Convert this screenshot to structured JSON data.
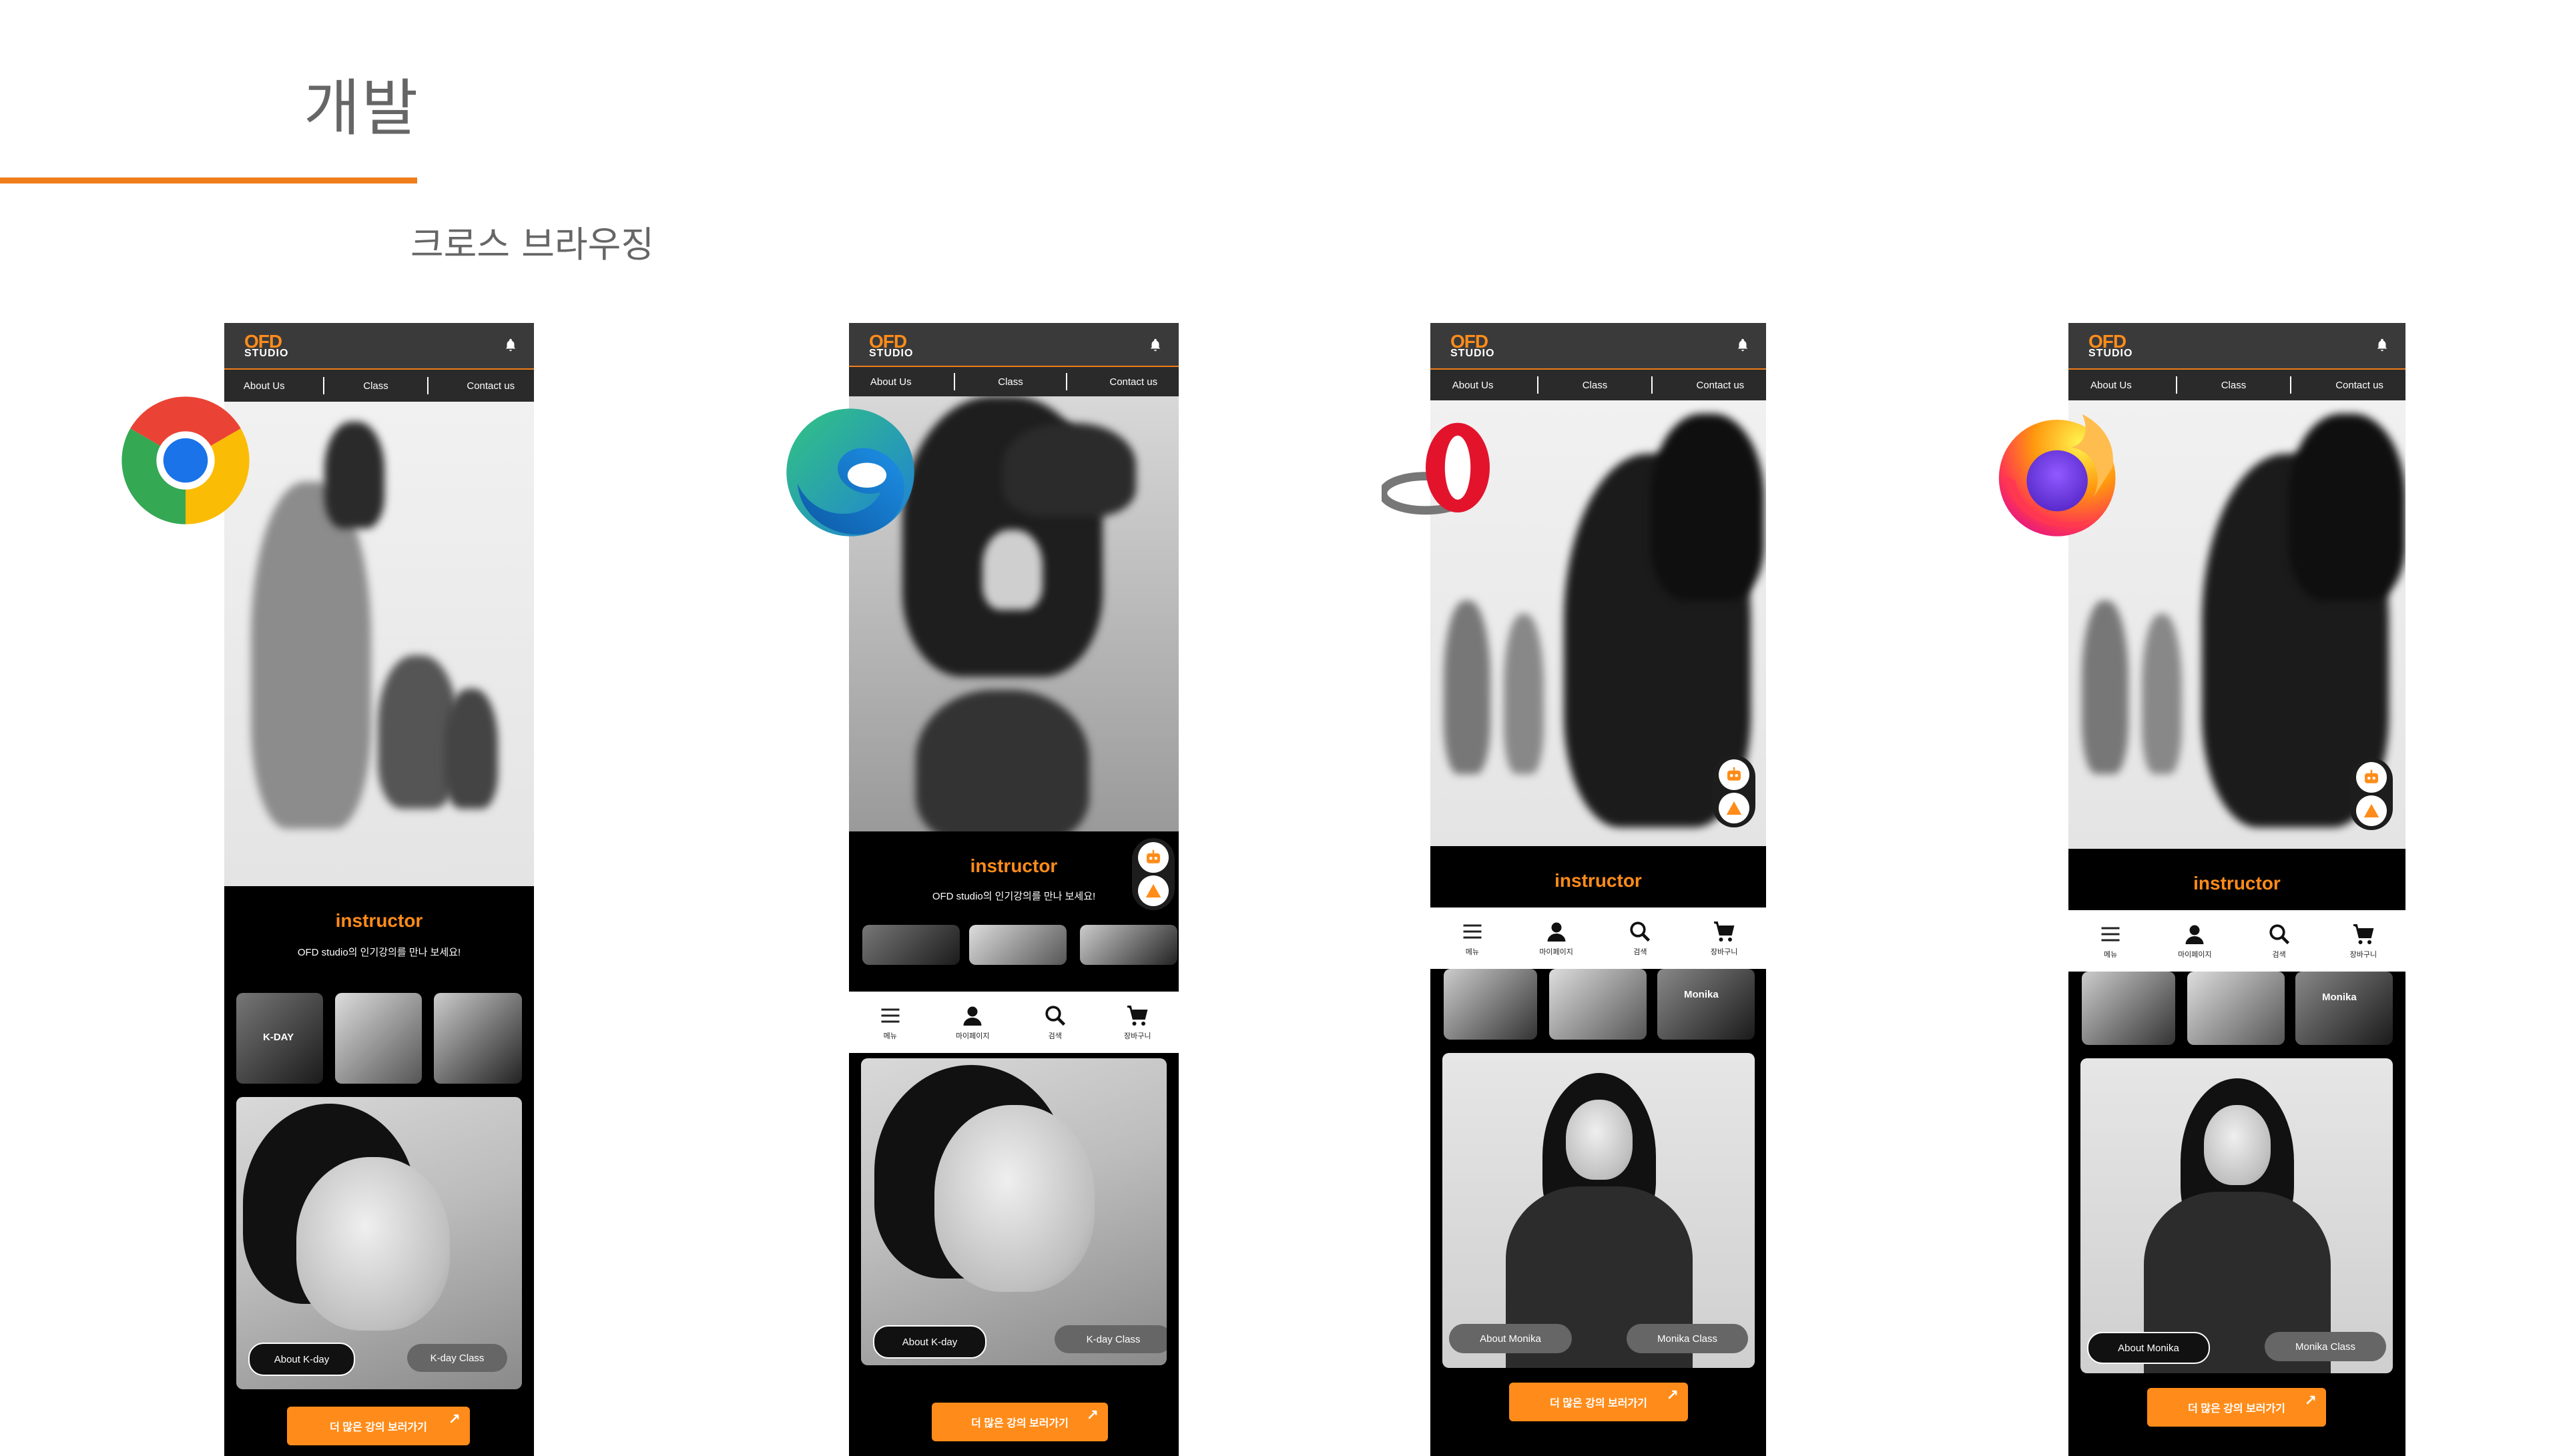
{
  "slide": {
    "title": "개발",
    "subtitle": "크로스 브라우징"
  },
  "colors": {
    "accent": "#ef7d1a",
    "orange": "#ff8c1a"
  },
  "browsers": [
    "chrome-icon",
    "edge-icon",
    "opera-icon",
    "firefox-icon"
  ],
  "app": {
    "logo_top": "OFD",
    "logo_bottom": "STUDIO",
    "nav": [
      "About Us",
      "Class",
      "Contact us"
    ],
    "instructor_title": "instructor",
    "instructor_sub": "OFD studio의 인기강의를 만나 보세요!",
    "thumb_kday": "K-DAY",
    "thumb_monika": "Monika",
    "about_kday": "About K-day",
    "kday_class": "K-day Class",
    "about_monika": "About Monika",
    "monika_class": "Monika Class",
    "more": "더 많은 강의 보러가기",
    "tabs": [
      "메뉴",
      "마이페이지",
      "검색",
      "장바구니"
    ]
  }
}
